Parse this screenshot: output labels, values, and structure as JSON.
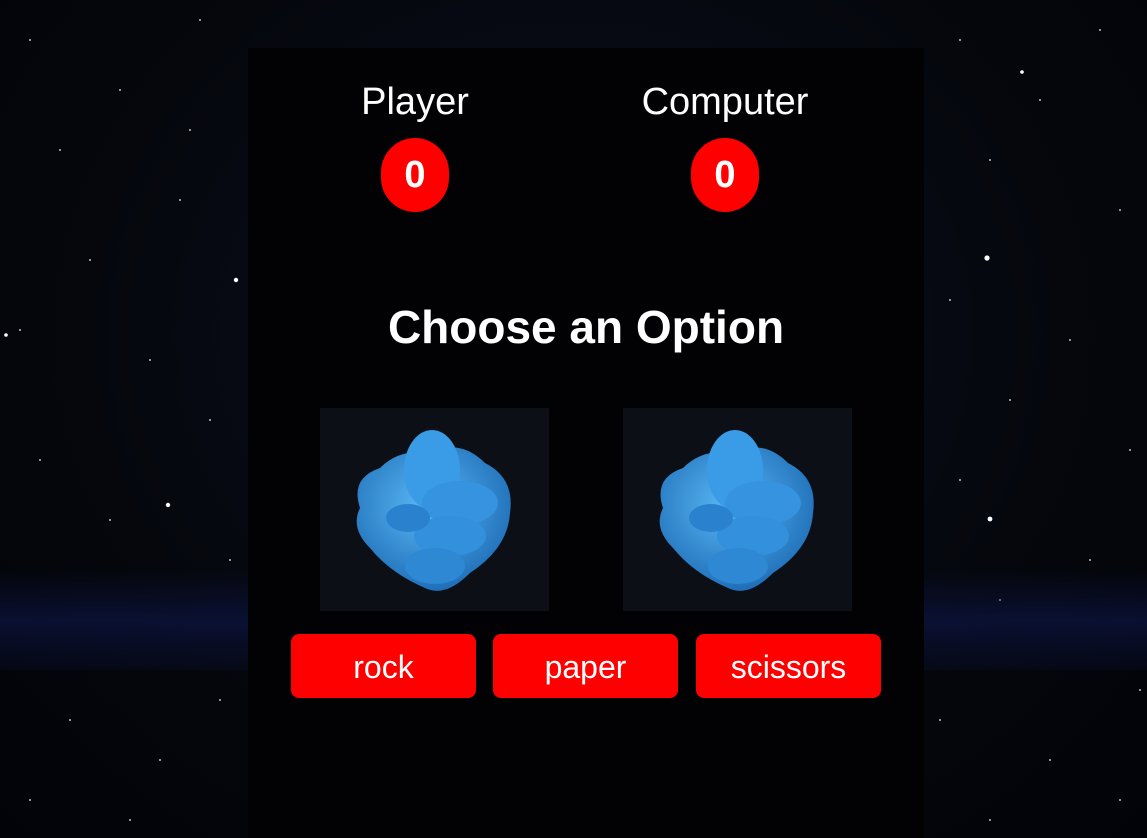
{
  "scoreboard": {
    "player": {
      "label": "Player",
      "score": "0"
    },
    "computer": {
      "label": "Computer",
      "score": "0"
    }
  },
  "prompt": "Choose an Option",
  "hands": {
    "player_icon": "rock-fist-icon",
    "computer_icon": "rock-fist-icon"
  },
  "choices": [
    "rock",
    "paper",
    "scissors"
  ],
  "colors": {
    "accent": "#ff0000",
    "panel": "#020204",
    "text": "#ffffff",
    "hand": "#2f8fdc"
  }
}
